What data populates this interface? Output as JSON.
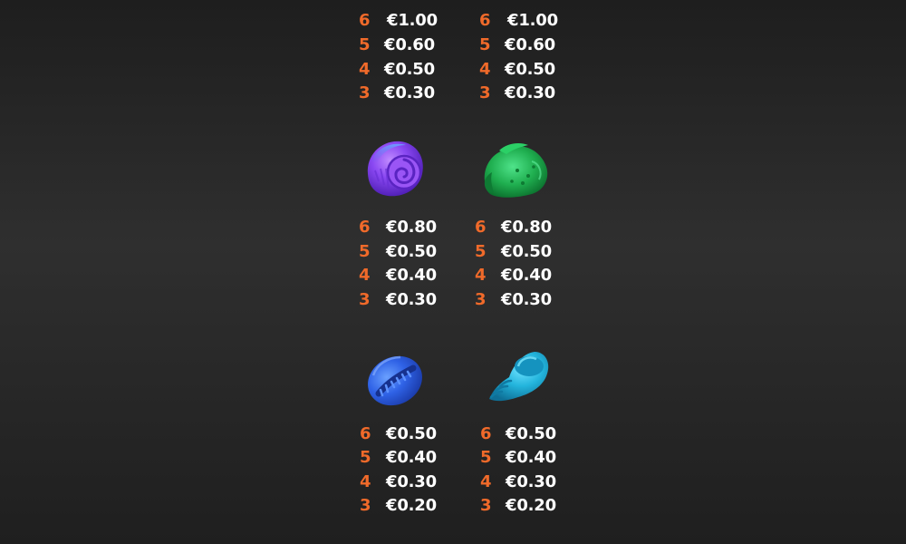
{
  "paytable": {
    "top_left": {
      "rows": [
        {
          "count": "6",
          "value": "€1.00"
        },
        {
          "count": "5",
          "value": "€0.60"
        },
        {
          "count": "4",
          "value": "€0.50"
        },
        {
          "count": "3",
          "value": "€0.30"
        }
      ]
    },
    "top_right": {
      "rows": [
        {
          "count": "6",
          "value": "€1.00"
        },
        {
          "count": "5",
          "value": "€0.60"
        },
        {
          "count": "4",
          "value": "€0.50"
        },
        {
          "count": "3",
          "value": "€0.30"
        }
      ]
    },
    "purple_snail_shell": {
      "icon": "purple-snail-shell-icon",
      "color": "#7a3df0",
      "rows": [
        {
          "count": "6",
          "value": "€0.80"
        },
        {
          "count": "5",
          "value": "€0.50"
        },
        {
          "count": "4",
          "value": "€0.40"
        },
        {
          "count": "3",
          "value": "€0.30"
        }
      ]
    },
    "green_shell": {
      "icon": "green-shell-icon",
      "color": "#22b050",
      "rows": [
        {
          "count": "6",
          "value": "€0.80"
        },
        {
          "count": "5",
          "value": "€0.50"
        },
        {
          "count": "4",
          "value": "€0.40"
        },
        {
          "count": "3",
          "value": "€0.30"
        }
      ]
    },
    "blue_cowrie_shell": {
      "icon": "blue-cowrie-shell-icon",
      "color": "#2a5fe0",
      "rows": [
        {
          "count": "6",
          "value": "€0.50"
        },
        {
          "count": "5",
          "value": "€0.40"
        },
        {
          "count": "4",
          "value": "€0.30"
        },
        {
          "count": "3",
          "value": "€0.20"
        }
      ]
    },
    "cyan_conch_shell": {
      "icon": "cyan-conch-shell-icon",
      "color": "#1fb4d8",
      "rows": [
        {
          "count": "6",
          "value": "€0.50"
        },
        {
          "count": "5",
          "value": "€0.40"
        },
        {
          "count": "4",
          "value": "€0.30"
        },
        {
          "count": "3",
          "value": "€0.20"
        }
      ]
    }
  }
}
